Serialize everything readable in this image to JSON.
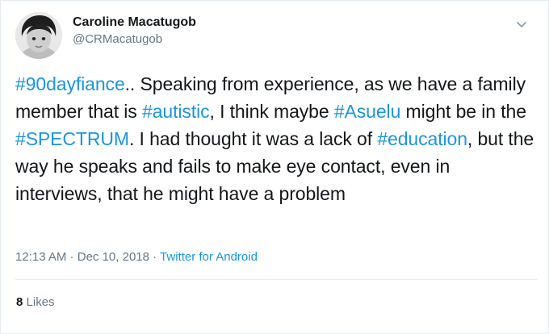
{
  "user": {
    "display_name": "Caroline Macatugob",
    "handle": "@CRMacatugob"
  },
  "tweet": {
    "segments": [
      {
        "text": "#90dayfiance",
        "hashtag": true
      },
      {
        "text": ".. Speaking from experience, as we have a family member that is ",
        "hashtag": false
      },
      {
        "text": "#autistic",
        "hashtag": true
      },
      {
        "text": ", I think maybe ",
        "hashtag": false
      },
      {
        "text": "#Asuelu",
        "hashtag": true
      },
      {
        "text": " might be in the ",
        "hashtag": false
      },
      {
        "text": "#SPECTRUM",
        "hashtag": true
      },
      {
        "text": ". I had thought it was a lack of ",
        "hashtag": false
      },
      {
        "text": "#education",
        "hashtag": true
      },
      {
        "text": ", but the way he speaks and fails to make eye contact, even in interviews, that he might have a problem",
        "hashtag": false
      }
    ]
  },
  "meta": {
    "time": "12:13 AM",
    "sep1": " · ",
    "date": "Dec 10, 2018",
    "sep2": " · ",
    "source": "Twitter for Android"
  },
  "stats": {
    "likes_count": "8",
    "likes_label": "Likes"
  },
  "colors": {
    "hashtag": "#1b95e0",
    "secondary_text": "#657786",
    "primary_text": "#14171a",
    "divider": "#e6ecf0"
  },
  "icons": {
    "caret": "chevron-down-icon"
  }
}
